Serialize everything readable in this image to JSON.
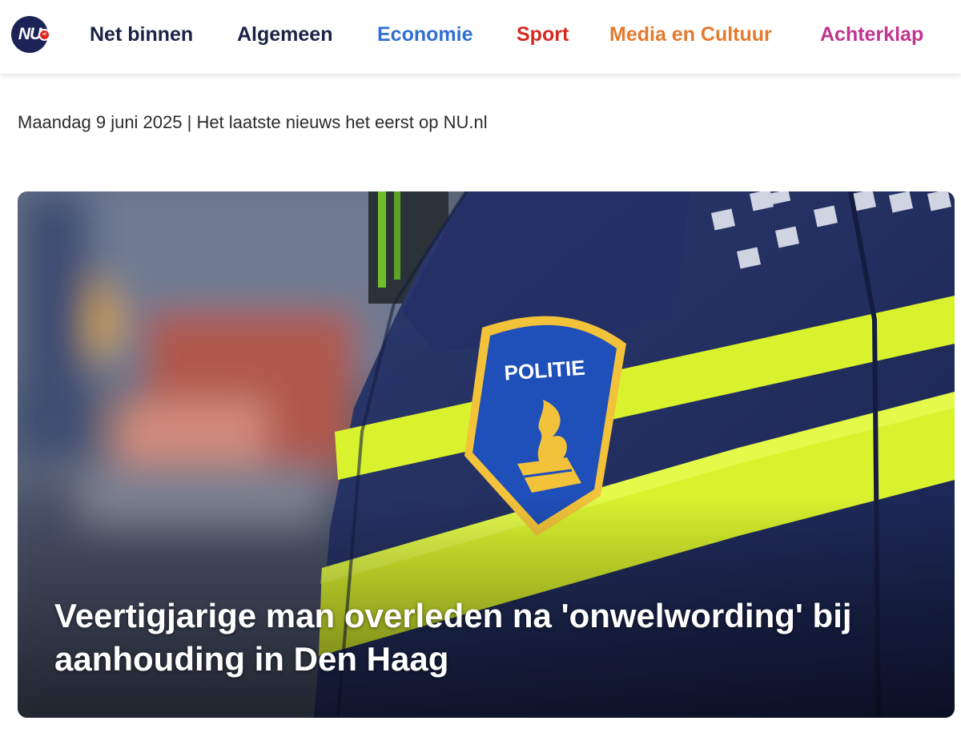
{
  "brand": {
    "logo_text": "NU",
    "logo_badge": "nl",
    "icon": "nu-logo"
  },
  "nav": {
    "items": [
      {
        "label": "Net binnen",
        "color": "#1b2345"
      },
      {
        "label": "Algemeen",
        "color": "#1b2345"
      },
      {
        "label": "Economie",
        "color": "#2f6fd1"
      },
      {
        "label": "Sport",
        "color": "#d42a22"
      },
      {
        "label": "Media en Cultuur",
        "color": "#e47a2e"
      },
      {
        "label": "Achterklap",
        "color": "#c0358f"
      }
    ]
  },
  "header": {
    "dateline": "Maandag 9 juni 2025 | Het laatste nieuws het eerst op NU.nl"
  },
  "hero": {
    "headline": "Veertigjarige man overleden na 'onwelwording' bij aanhouding in Den Haag",
    "image": {
      "subject": "police-officer-uniform-photo",
      "patch_text": "POLITIE"
    }
  }
}
